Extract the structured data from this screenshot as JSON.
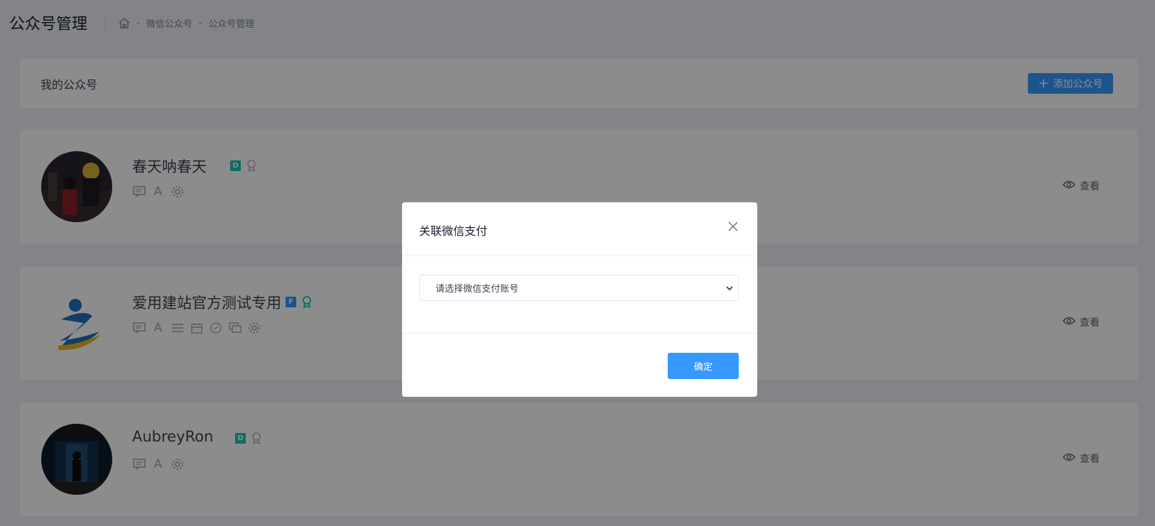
{
  "header": {
    "title": "公众号管理",
    "breadcrumb": [
      "微信公众号",
      "公众号管理"
    ],
    "separator": "-"
  },
  "panel": {
    "title": "我的公众号",
    "add_button": "添加公众号"
  },
  "accounts": [
    {
      "name": "春天呐春天",
      "badge": "D",
      "verified": false,
      "tools": [
        "message-icon",
        "font-icon",
        "gear-icon"
      ],
      "view_label": "查看"
    },
    {
      "name": "爱用建站官方测试专用",
      "badge": "F",
      "verified": true,
      "tools": [
        "message-icon",
        "font-icon",
        "menu-icon",
        "calendar-icon",
        "link-icon",
        "chat-icon",
        "gear-icon"
      ],
      "view_label": "查看"
    },
    {
      "name": "AubreyRon",
      "badge": "D",
      "verified": false,
      "tools": [
        "message-icon",
        "font-icon",
        "gear-icon"
      ],
      "view_label": "查看"
    }
  ],
  "modal": {
    "title": "关联微信支付",
    "select_placeholder": "请选择微信支付账号",
    "confirm_label": "确定"
  },
  "colors": {
    "primary": "#3699ff",
    "badge_d": "#1bc5bd",
    "badge_f": "#3699ff",
    "page_bg": "#eef0f8"
  }
}
